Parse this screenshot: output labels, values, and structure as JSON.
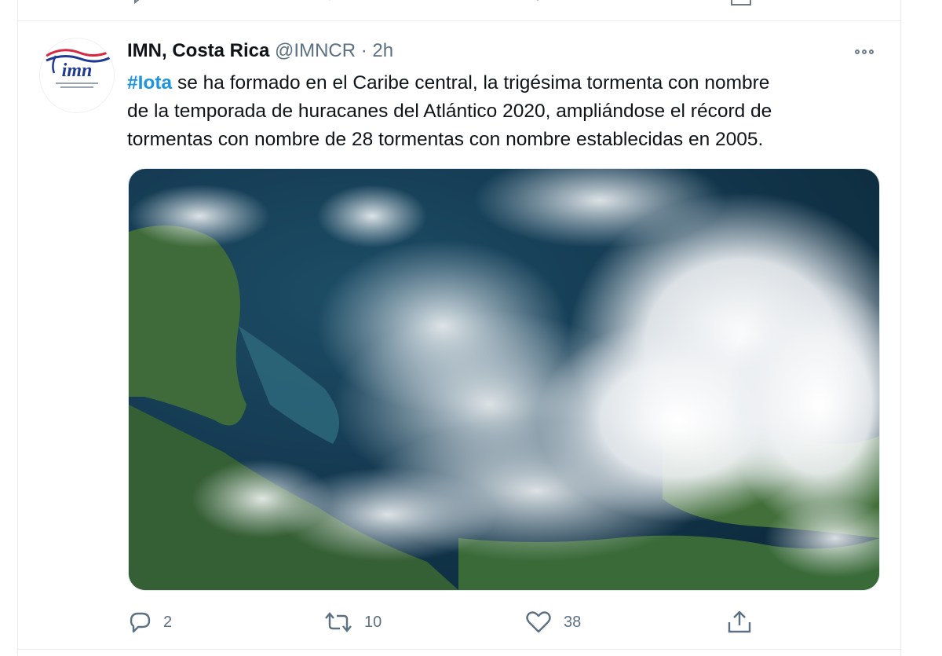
{
  "tweet": {
    "author": {
      "name": "IMN, Costa Rica",
      "handle": "@IMNCR",
      "separator": "·",
      "time": "2h"
    },
    "avatar": {
      "logo_text": "imn",
      "brand_colors": [
        "#1f3a93",
        "#d7263d"
      ]
    },
    "text": {
      "hashtag": "#Iota",
      "line1_rest": " se ha formado en el Caribe central, la trigésima tormenta con nombre",
      "line2": "de la temporada de huracanes del Atlántico 2020, ampliándose el récord de",
      "line3": "tormentas con nombre de 28 tormentas con nombre establecidas en 2005."
    },
    "media": {
      "description": "satellite-image"
    },
    "actions": {
      "reply": {
        "icon": "reply-icon",
        "count": "2"
      },
      "retweet": {
        "icon": "retweet-icon",
        "count": "10"
      },
      "like": {
        "icon": "heart-icon",
        "count": "38"
      },
      "share": {
        "icon": "share-icon"
      }
    },
    "colors": {
      "hashtag": "#1b95e0",
      "secondary_text": "#5b7083",
      "border": "#e6ecf0"
    }
  }
}
